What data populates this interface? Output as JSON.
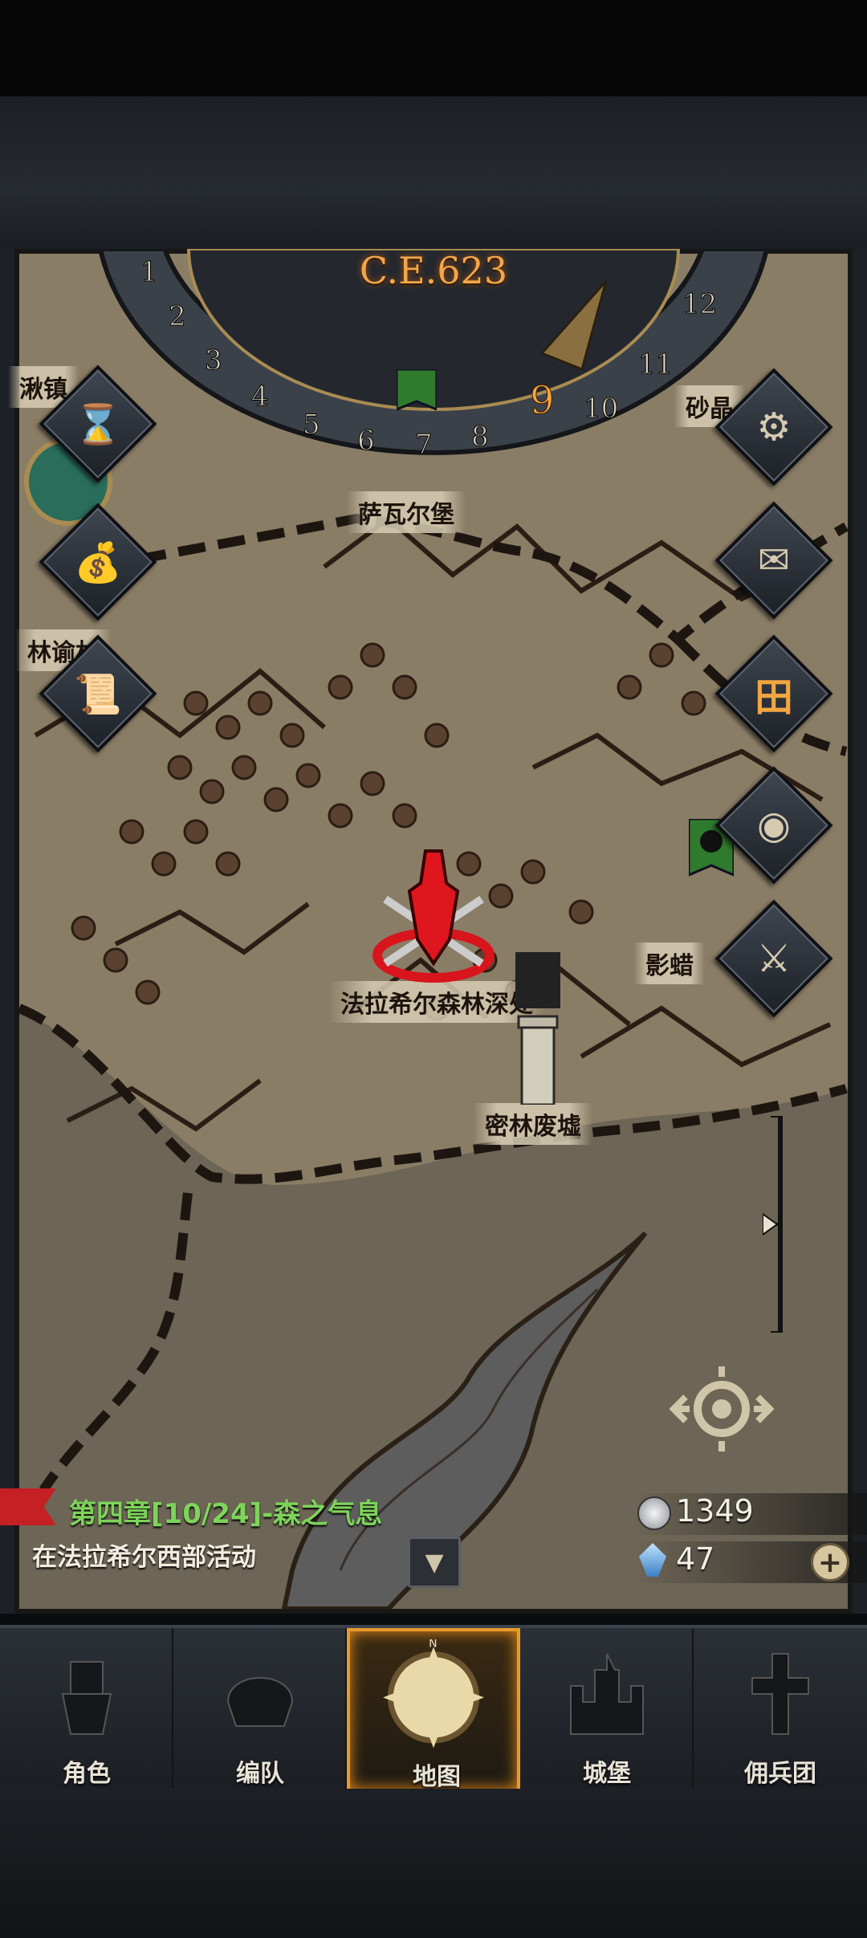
{
  "calendar": {
    "year": "C.E.623",
    "months": [
      "1",
      "2",
      "3",
      "4",
      "5",
      "6",
      "7",
      "8",
      "9",
      "10",
      "11",
      "12"
    ],
    "current_month": "9"
  },
  "map_labels": {
    "town_top_left": "湫镇",
    "town_top_right": "砂晶",
    "fort_sawaer": "萨瓦尔堡",
    "village_linyu": "林谕村",
    "forest_deep": "法拉希尔森林深处",
    "shadow": "影蜡",
    "ruins": "密林废墟"
  },
  "left_buttons": [
    {
      "icon": "hourglass-icon",
      "glyph": "⌛"
    },
    {
      "icon": "money-bag-icon",
      "glyph": "💰"
    },
    {
      "icon": "scroll-icon",
      "glyph": "📜"
    }
  ],
  "right_buttons": [
    {
      "icon": "gear-icon",
      "glyph": "⚙"
    },
    {
      "icon": "mail-icon",
      "glyph": "✉"
    },
    {
      "icon": "grid-icon",
      "glyph": "田"
    },
    {
      "icon": "drum-icon",
      "glyph": "◉"
    },
    {
      "icon": "helmet-icon",
      "glyph": "⚔"
    }
  ],
  "quest": {
    "title": "第四章[10/24]-森之气息",
    "description": "在法拉希尔西部活动"
  },
  "resources": {
    "silver": "1349",
    "crystal": "47"
  },
  "nav": {
    "items": [
      {
        "label": "角色",
        "icon": "knight-icon"
      },
      {
        "label": "编队",
        "icon": "helmet-icon"
      },
      {
        "label": "地图",
        "icon": "compass-icon"
      },
      {
        "label": "城堡",
        "icon": "castle-icon"
      },
      {
        "label": "佣兵团",
        "icon": "mercenary-icon"
      }
    ],
    "active_index": 2,
    "compass_n": "N"
  },
  "colors": {
    "accent": "#e79b2a",
    "quest_green": "#7ed35b",
    "year_orange": "#f2a64a",
    "marker_red": "#d8141c"
  }
}
